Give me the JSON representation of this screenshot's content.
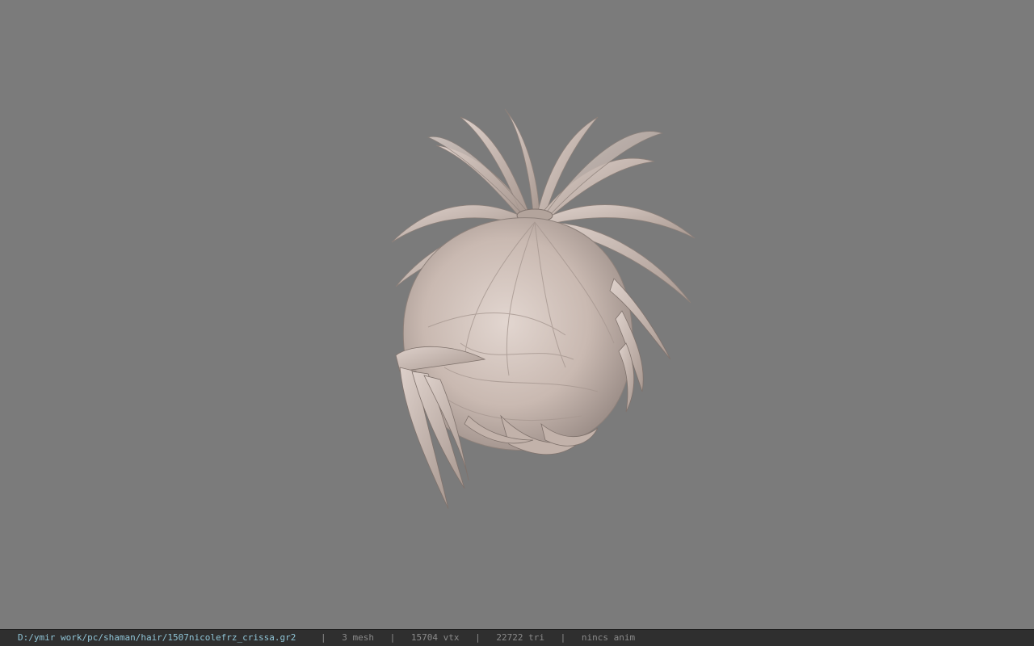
{
  "viewport": {
    "background_color": "#7b7b7b",
    "model_color": "#cdbfb8"
  },
  "statusbar": {
    "file_path": "D:/ymir work/pc/shaman/hair/1507nicolefrz_crissa.gr2",
    "separator": "|",
    "mesh": "3 mesh",
    "vtx": "15704 vtx",
    "tri": "22722 tri",
    "anim": "nincs anim"
  }
}
